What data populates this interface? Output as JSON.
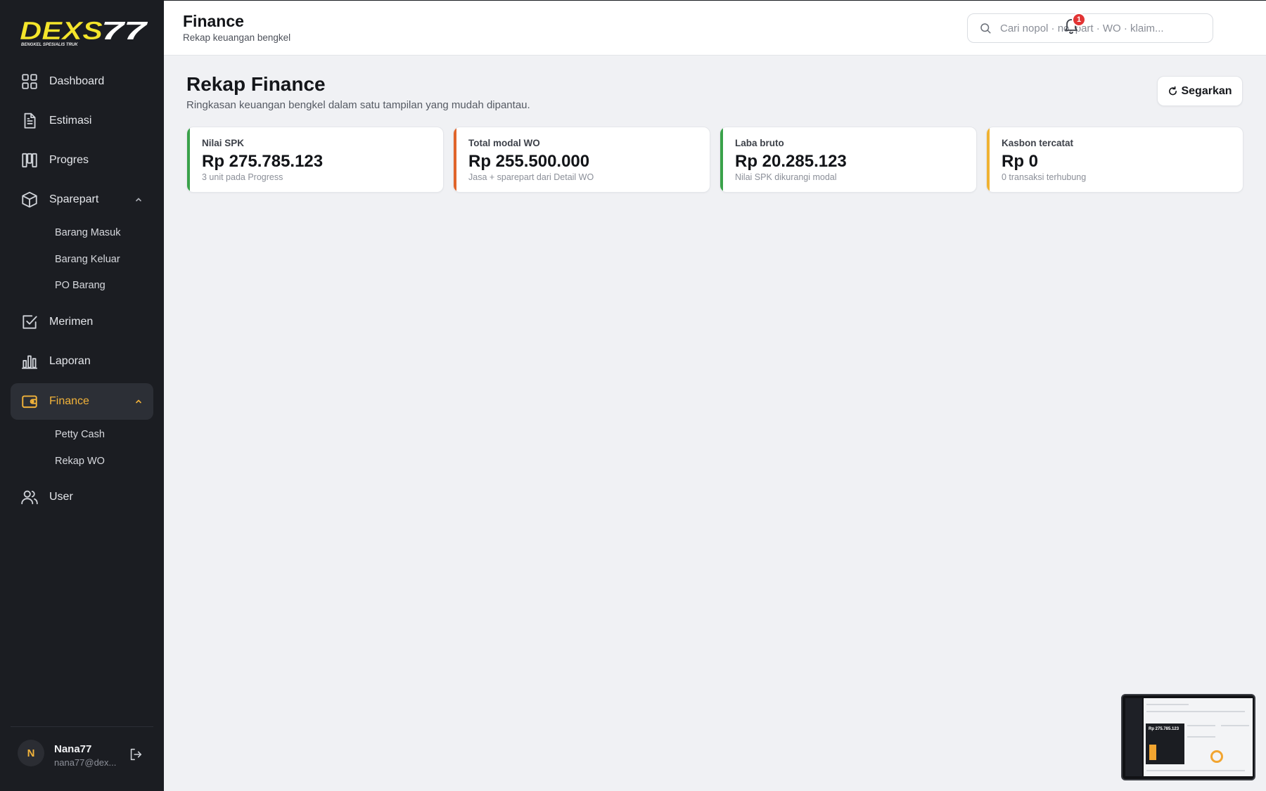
{
  "app": {
    "brand": "DEXS77",
    "tagline": "BENGKEL SPESIALIS TRUK"
  },
  "colors": {
    "sidebar_bg": "#1b1d22",
    "accent": "#f2b33a",
    "green": "#3aa24a",
    "orange": "#e0642a",
    "yellow": "#f0b232"
  },
  "sidebar": {
    "items": [
      {
        "label": "Dashboard",
        "icon": "grid-icon"
      },
      {
        "label": "Estimasi",
        "icon": "document-icon"
      },
      {
        "label": "Progres",
        "icon": "columns-icon"
      },
      {
        "label": "Sparepart",
        "icon": "box-icon",
        "expanded": true,
        "children": [
          "Barang Masuk",
          "Barang Keluar",
          "PO Barang"
        ]
      },
      {
        "label": "Merimen",
        "icon": "checkbox-icon"
      },
      {
        "label": "Laporan",
        "icon": "bar-chart-icon"
      },
      {
        "label": "Finance",
        "icon": "wallet-icon",
        "active": true,
        "expanded": true,
        "children": [
          "Petty Cash",
          "Rekap WO"
        ]
      },
      {
        "label": "User",
        "icon": "users-icon"
      }
    ]
  },
  "user": {
    "initial": "N",
    "name": "Nana77",
    "email": "nana77@dex..."
  },
  "header": {
    "title": "Finance",
    "subtitle": "Rekap keuangan bengkel",
    "search_placeholder": "Cari nopol · no. part · WO · klaim...",
    "notification_count": "1"
  },
  "main": {
    "title": "Rekap Finance",
    "subtitle": "Ringkasan keuangan bengkel dalam satu tampilan yang mudah dipantau.",
    "refresh_label": "Segarkan",
    "cards": [
      {
        "label": "Nilai SPK",
        "value": "Rp 275.785.123",
        "note": "3 unit pada Progress",
        "accent": "#3aa24a"
      },
      {
        "label": "Total modal WO",
        "value": "Rp 255.500.000",
        "note": "Jasa + sparepart dari Detail WO",
        "accent": "#e0642a"
      },
      {
        "label": "Laba bruto",
        "value": "Rp 20.285.123",
        "note": "Nilai SPK dikurangi modal",
        "accent": "#3aa24a"
      },
      {
        "label": "Kasbon tercatat",
        "value": "Rp 0",
        "note": "0 transaksi terhubung",
        "accent": "#f0b232"
      }
    ]
  },
  "preview": {
    "value": "Rp 275.785.123"
  }
}
